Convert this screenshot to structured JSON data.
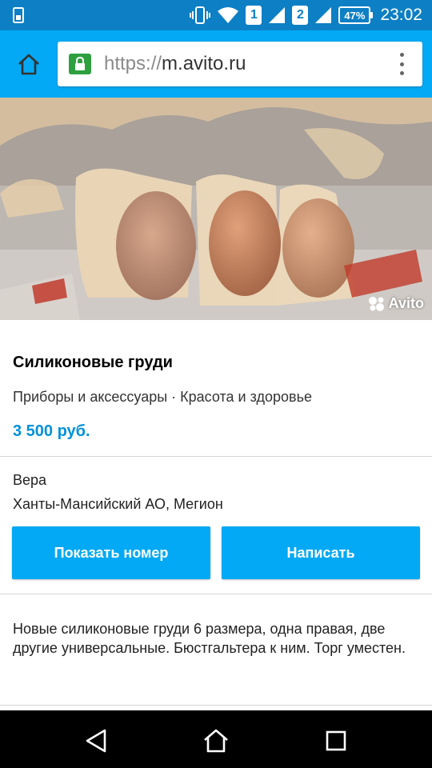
{
  "status_bar": {
    "sim1": "1",
    "sim2": "2",
    "battery": "47%",
    "time": "23:02"
  },
  "browser": {
    "url_protocol": "https://",
    "url_host": "m.avito.ru",
    "home_icon": "home-icon",
    "lock_icon": "lock-icon",
    "menu_icon": "more-vert-icon"
  },
  "listing": {
    "photo_watermark": "Avito",
    "title": "Силиконовые груди",
    "category": "Приборы и аксессуары · Красота и здоровье",
    "price": "3 500 руб.",
    "seller_name": "Вера",
    "location": "Ханты-Мансийский АО, Мегион",
    "show_number_label": "Показать номер",
    "write_label": "Написать",
    "description": "Новые силиконовые груди 6 размера, одна правая, две другие универсальные. Бюстгальтера к ним. Торг уместен."
  },
  "nav": {
    "back_icon": "back-triangle-icon",
    "home_icon": "home-outline-icon",
    "recents_icon": "recents-square-icon"
  },
  "colors": {
    "status_bar": "#0d7fc4",
    "toolbar": "#03a9f4",
    "button": "#03a9f4",
    "price": "#0091d9"
  }
}
